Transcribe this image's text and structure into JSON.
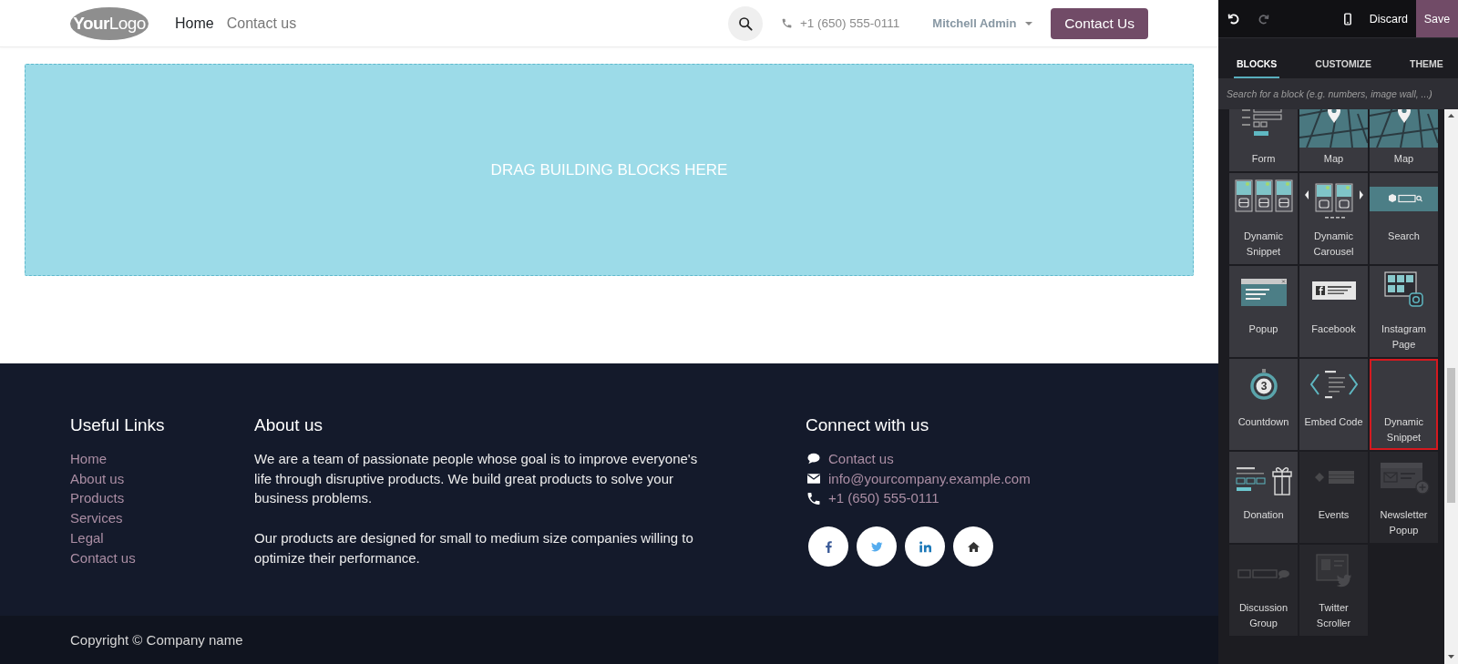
{
  "header": {
    "logo": "**Your**Logo",
    "nav": [
      {
        "label": "Home",
        "selected": true
      },
      {
        "label": "Contact us",
        "selected": false
      }
    ],
    "phone": "+1 (650) 555-0111",
    "user": "Mitchell Admin",
    "cta": "Contact Us"
  },
  "drop_zone": {
    "text": "DRAG BUILDING BLOCKS HERE"
  },
  "footer": {
    "links": {
      "title": "Useful Links",
      "items": [
        "Home",
        "About us",
        "Products",
        "Services",
        "Legal",
        "Contact us"
      ]
    },
    "about": {
      "title": "About us",
      "paragraphs": [
        "We are a team of passionate people whose goal is to improve everyone's life through disruptive products. We build great products to solve your business problems.",
        "Our products are designed for small to medium size companies willing to optimize their performance."
      ]
    },
    "connect": {
      "title": "Connect with us",
      "items": [
        {
          "kind": "chat",
          "text": "Contact us"
        },
        {
          "kind": "email",
          "text": "info@yourcompany.example.com"
        },
        {
          "kind": "phone",
          "text": "+1 (650) 555-0111"
        }
      ],
      "social": [
        {
          "kind": "facebook"
        },
        {
          "kind": "twitter"
        },
        {
          "kind": "linkedin"
        },
        {
          "kind": "home"
        }
      ]
    },
    "copyright": "Copyright © Company name"
  },
  "editor": {
    "toolbar": {
      "undo_disabled": false,
      "redo_disabled": true,
      "discard": "Discard",
      "save": "Save"
    },
    "tabs": [
      {
        "label": "BLOCKS",
        "selected": true
      },
      {
        "label": "CUSTOMIZE",
        "selected": false
      },
      {
        "label": "THEME",
        "selected": false
      }
    ],
    "search": {
      "placeholder": "Search for a block (e.g. numbers, image wall, ...)"
    },
    "blocks": [
      {
        "label": "Form",
        "kind": "form",
        "disabled": false,
        "selected": false
      },
      {
        "label": "Map",
        "kind": "map",
        "disabled": false,
        "selected": false
      },
      {
        "label": "Map",
        "kind": "map",
        "disabled": false,
        "selected": false
      },
      {
        "label": "Dynamic Snippet",
        "kind": "dynamic",
        "disabled": false,
        "selected": false
      },
      {
        "label": "Dynamic Carousel",
        "kind": "carousel",
        "disabled": false,
        "selected": false
      },
      {
        "label": "Search",
        "kind": "search",
        "disabled": false,
        "selected": false
      },
      {
        "label": "Popup",
        "kind": "popup",
        "disabled": false,
        "selected": false
      },
      {
        "label": "Facebook",
        "kind": "facebook",
        "disabled": false,
        "selected": false
      },
      {
        "label": "Instagram Page",
        "kind": "instagram",
        "disabled": false,
        "selected": false
      },
      {
        "label": "Countdown",
        "kind": "countdown",
        "number": "3",
        "disabled": false,
        "selected": false
      },
      {
        "label": "Embed Code",
        "kind": "embed",
        "disabled": false,
        "selected": false
      },
      {
        "label": "Dynamic Snippet",
        "kind": "blank",
        "disabled": false,
        "selected": true
      },
      {
        "label": "Donation",
        "kind": "donation",
        "disabled": false,
        "selected": false
      },
      {
        "label": "Events",
        "kind": "events",
        "disabled": true,
        "selected": false
      },
      {
        "label": "Newsletter Popup",
        "kind": "newsletter",
        "disabled": true,
        "selected": false
      },
      {
        "label": "Discussion Group",
        "kind": "discussion",
        "disabled": true,
        "selected": false
      },
      {
        "label": "Twitter Scroller",
        "kind": "twitter",
        "disabled": true,
        "selected": false
      }
    ]
  }
}
